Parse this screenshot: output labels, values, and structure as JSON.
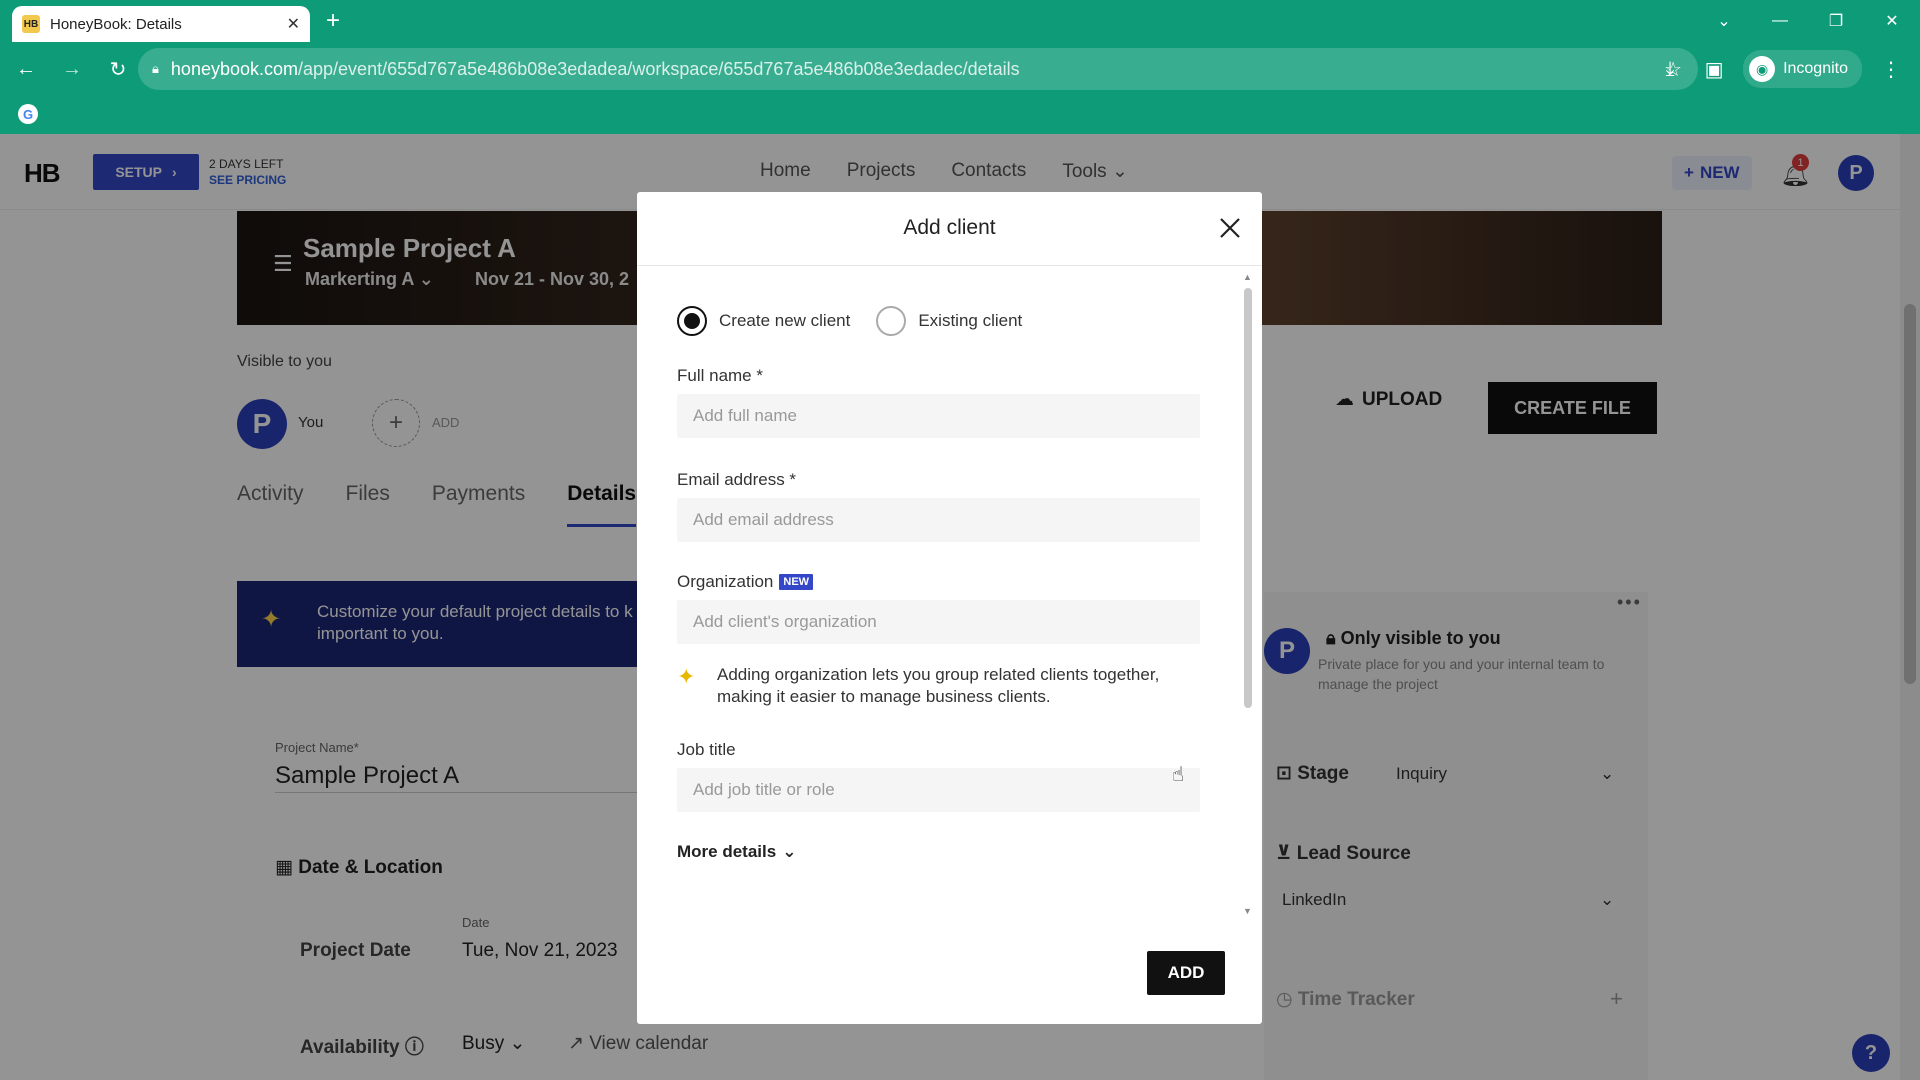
{
  "browser": {
    "tab_title": "HoneyBook: Details",
    "tab_favicon": "HB",
    "url_host": "honeybook.com",
    "url_path": "/app/event/655d767a5e486b08e3edadea/workspace/655d767a5e486b08e3edadec/details",
    "incognito_label": "Incognito"
  },
  "header": {
    "logo": "HB",
    "setup_label": "SETUP",
    "days_left": "2 DAYS LEFT",
    "see_pricing": "SEE PRICING",
    "nav": [
      "Home",
      "Projects",
      "Contacts",
      "Tools"
    ],
    "new_label": "NEW",
    "notif_count": "1",
    "avatar_letter": "P"
  },
  "project": {
    "title": "Sample Project A",
    "client": "Markerting A",
    "dates": "Nov 21 - Nov 30, 2",
    "visible_to": "Visible to you",
    "you_label": "You",
    "add_label": "ADD",
    "tabs": [
      "Activity",
      "Files",
      "Payments",
      "Details"
    ],
    "promo_text": "Customize your default project details to k that's important to you.",
    "project_name_label": "Project Name*",
    "project_name_value": "Sample Project A",
    "date_location_title": "Date & Location",
    "project_date_label": "Project Date",
    "date_small_label": "Date",
    "date_value": "Tue, Nov 21, 2023",
    "availability_label": "Availability",
    "busy_value": "Busy",
    "view_calendar": "View calendar",
    "upload_label": "UPLOAD",
    "create_file_label": "CREATE FILE"
  },
  "right_panel": {
    "only_visible": "Only visible to you",
    "private_desc": "Private place for you and your internal team to manage the project",
    "stage_label": "Stage",
    "stage_value": "Inquiry",
    "lead_source_label": "Lead Source",
    "lead_source_value": "LinkedIn",
    "time_tracker_label": "Time Tracker"
  },
  "modal": {
    "title": "Add client",
    "radio_new": "Create new client",
    "radio_existing": "Existing client",
    "full_name_label": "Full name *",
    "full_name_placeholder": "Add full name",
    "email_label": "Email address *",
    "email_placeholder": "Add email address",
    "org_label": "Organization",
    "org_badge": "NEW",
    "org_placeholder": "Add client's organization",
    "org_note": "Adding organization lets you group related clients together, making it easier to manage business clients.",
    "job_title_label": "Job title",
    "job_title_placeholder": "Add job title or role",
    "more_details": "More details",
    "add_button": "ADD"
  },
  "help_label": "?",
  "colors": {
    "chrome": "#0e9c78",
    "brand": "#3547c9",
    "black_button": "#111111"
  }
}
